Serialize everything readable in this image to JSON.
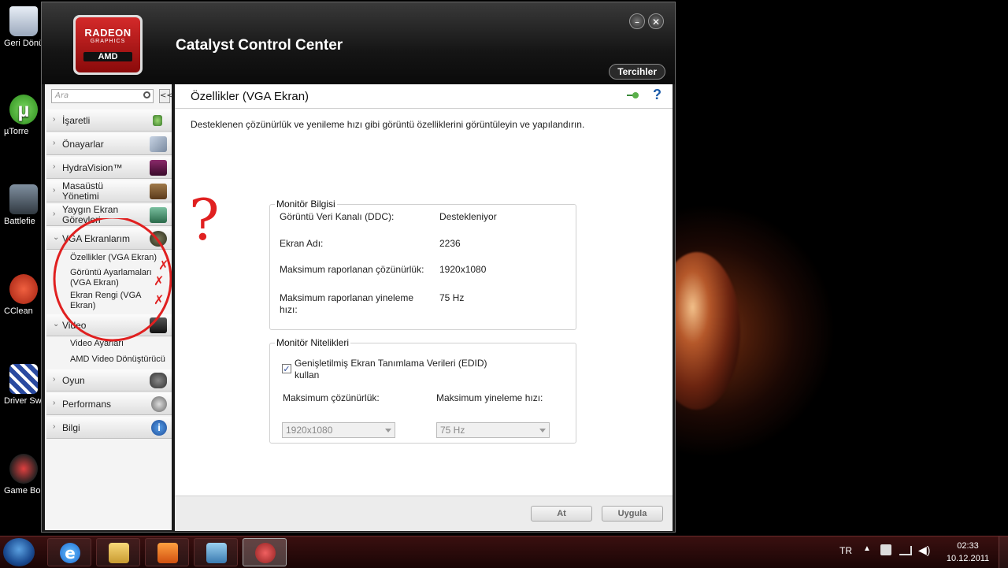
{
  "desktop": {
    "icons": [
      {
        "label": "Geri Dönüşü",
        "color": "#c0c8d8"
      },
      {
        "label": "µTorre",
        "color": "#4aa83a"
      },
      {
        "label": "Battlefie",
        "color": "#556070"
      },
      {
        "label": "CClean",
        "color": "#d04030"
      },
      {
        "label": "Driver Sweep",
        "color": "#3050a0"
      },
      {
        "label": "Game Booste",
        "color": "#b02020"
      }
    ]
  },
  "window": {
    "logo": {
      "line1": "RADEON",
      "line2": "GRAPHICS",
      "line3": "AMD"
    },
    "title": "Catalyst Control Center",
    "minimize_icon": "minimize-icon",
    "close_icon": "close-icon",
    "preferences_label": "Tercihler"
  },
  "sidebar": {
    "search_placeholder": "Ara",
    "collapse_label": "<<",
    "items": [
      {
        "label": "İşaretli",
        "icon": "pin-icon",
        "color": "#6aa84f"
      },
      {
        "label": "Önayarlar",
        "icon": "preset-icon",
        "color": "#8a9ab0"
      },
      {
        "label": "HydraVision™",
        "icon": "monitor-icon",
        "color": "#6a1a4a"
      },
      {
        "label": "Masaüstü Yönetimi",
        "icon": "desktop-management-icon",
        "color": "#7a5a3a"
      },
      {
        "label": "Yaygın Ekran Görevleri",
        "icon": "display-tasks-icon",
        "color": "#4a8a6a"
      },
      {
        "label": "VGA Ekranlarım",
        "icon": "vga-display-icon",
        "color": "#4a4a3a"
      },
      {
        "label": "Video",
        "icon": "video-camera-icon",
        "color": "#333333"
      },
      {
        "label": "Oyun",
        "icon": "gamepad-icon",
        "color": "#555555"
      },
      {
        "label": "Performans",
        "icon": "gauge-icon",
        "color": "#444444"
      },
      {
        "label": "Bilgi",
        "icon": "info-icon",
        "color": "#2a6ab0"
      }
    ],
    "vga_sub": [
      "Özellikler (VGA Ekran)",
      "Görüntü Ayarlamaları (VGA Ekran)",
      "Ekran Rengi (VGA Ekran)"
    ],
    "video_sub": [
      "Video Ayarları",
      "AMD Video Dönüştürücü"
    ]
  },
  "content": {
    "title": "Özellikler (VGA Ekran)",
    "description": "Desteklenen çözünürlük ve yenileme hızı gibi görüntü özelliklerini görüntüleyin ve yapılandırın.",
    "monitor_info": {
      "title": "Monitör Bilgisi",
      "rows": [
        {
          "label": "Görüntü Veri Kanalı (DDC):",
          "value": "Destekleniyor"
        },
        {
          "label": "Ekran Adı:",
          "value": "2236"
        },
        {
          "label": "Maksimum raporlanan çözünürlük:",
          "value": "1920x1080"
        },
        {
          "label": "Maksimum raporlanan yineleme hızı:",
          "value": "75 Hz"
        }
      ]
    },
    "monitor_features": {
      "title": "Monitör Nitelikleri",
      "edid_label": "Genişletilmiş Ekran Tanımlama Verileri (EDID) kullan",
      "edid_checked": true,
      "max_res_label": "Maksimum çözünürlük:",
      "max_rate_label": "Maksimum yineleme hızı:",
      "max_res_value": "1920x1080",
      "max_rate_value": "75 Hz"
    },
    "buttons": {
      "discard": "At",
      "apply": "Uygula"
    },
    "annotation": {
      "question": "?",
      "cross": "✗",
      "color": "#e02020"
    }
  },
  "taskbar": {
    "items": [
      {
        "name": "internet-explorer",
        "color": "#1a7ad8"
      },
      {
        "name": "file-explorer",
        "color": "#e0b040"
      },
      {
        "name": "media-player",
        "color": "#e07020"
      },
      {
        "name": "control-panel",
        "color": "#3a8ad0"
      },
      {
        "name": "catalyst-control-center",
        "color": "#c03030"
      }
    ],
    "language": "TR",
    "time": "02:33",
    "date": "10.12.2011"
  }
}
